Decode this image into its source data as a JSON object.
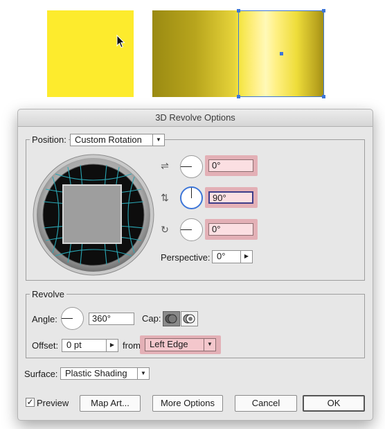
{
  "dialog": {
    "title": "3D Revolve Options"
  },
  "position": {
    "label": "Position:",
    "preset": "Custom Rotation",
    "x_rotation": "0°",
    "y_rotation": "90°",
    "z_rotation": "0°",
    "perspective_label": "Perspective:",
    "perspective_value": "0°"
  },
  "revolve": {
    "legend": "Revolve",
    "angle_label": "Angle:",
    "angle_value": "360°",
    "cap_label": "Cap:",
    "offset_label": "Offset:",
    "offset_value": "0 pt",
    "from_label": "from",
    "from_value": "Left Edge"
  },
  "surface": {
    "label": "Surface:",
    "value": "Plastic Shading"
  },
  "footer": {
    "preview_label": "Preview",
    "preview_checked": true,
    "map_art": "Map Art...",
    "more_options": "More Options",
    "cancel": "Cancel",
    "ok": "OK"
  },
  "icons": {
    "x_axis": "x-rotation-axis-icon",
    "y_axis": "y-rotation-axis-icon",
    "z_axis": "z-rotation-axis-icon",
    "cap_on": "cap-on-icon",
    "cap_off": "cap-off-icon",
    "cursor": "arrow-cursor-icon"
  },
  "colors": {
    "swatch_yellow": "#fdeb2d",
    "selection": "#3d76d8",
    "highlight": "#e3b0b6",
    "field_highlight": "#fbdfe2",
    "cube_wire": "#2aa7b5"
  }
}
